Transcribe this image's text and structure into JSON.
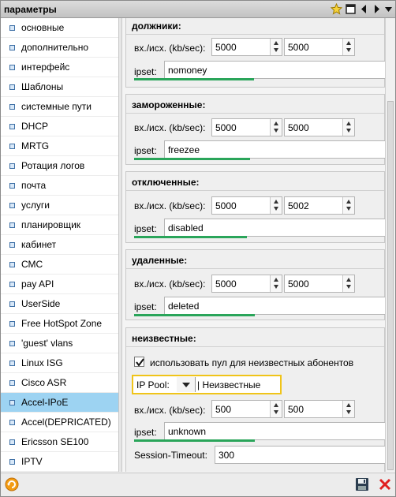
{
  "window": {
    "title": "параметры"
  },
  "sidebar": {
    "items": [
      {
        "label": "основные"
      },
      {
        "label": "дополнительно"
      },
      {
        "label": "интерфейс"
      },
      {
        "label": "Шаблоны"
      },
      {
        "label": "системные пути"
      },
      {
        "label": "DHCP"
      },
      {
        "label": "MRTG"
      },
      {
        "label": "Ротация логов"
      },
      {
        "label": "почта"
      },
      {
        "label": "услуги"
      },
      {
        "label": "планировщик"
      },
      {
        "label": "кабинет"
      },
      {
        "label": "СМС"
      },
      {
        "label": "pay API"
      },
      {
        "label": "UserSide"
      },
      {
        "label": "Free HotSpot Zone"
      },
      {
        "label": "'guest' vlans"
      },
      {
        "label": "Linux ISG"
      },
      {
        "label": "Cisco ASR"
      },
      {
        "label": "Accel-IPoE",
        "active": true
      },
      {
        "label": "Accel(DEPRICATED)"
      },
      {
        "label": "Ericsson SE100"
      },
      {
        "label": "IPTV"
      }
    ]
  },
  "sections": [
    {
      "title": "должники:",
      "inout_label": "вх./исх. (kb/sec):",
      "in": "5000",
      "out": "5000",
      "ipset_label": "ipset:",
      "ipset": "nomoney"
    },
    {
      "title": "замороженные:",
      "inout_label": "вх./исх. (kb/sec):",
      "in": "5000",
      "out": "5000",
      "ipset_label": "ipset:",
      "ipset": "freezee"
    },
    {
      "title": "отключенные:",
      "inout_label": "вх./исх. (kb/sec):",
      "in": "5000",
      "out": "5002",
      "ipset_label": "ipset:",
      "ipset": "disabled"
    },
    {
      "title": "удаленные:",
      "inout_label": "вх./исх. (kb/sec):",
      "in": "5000",
      "out": "5000",
      "ipset_label": "ipset:",
      "ipset": "deleted"
    },
    {
      "title": "неизвестные:",
      "checkbox_label": "использовать пул для неизвестных абонентов",
      "checkbox_checked": true,
      "pool_label": "IP Pool:",
      "pool_value": "| Неизвестные",
      "inout_label": "вх./исх. (kb/sec):",
      "in": "500",
      "out": "500",
      "ipset_label": "ipset:",
      "ipset": "unknown",
      "timeout_label": "Session-Timeout:",
      "timeout": "300"
    }
  ],
  "colors": {
    "accent_green": "#2aa55a",
    "active_item": "#9dd3f2",
    "highlight": "#f0c419"
  }
}
